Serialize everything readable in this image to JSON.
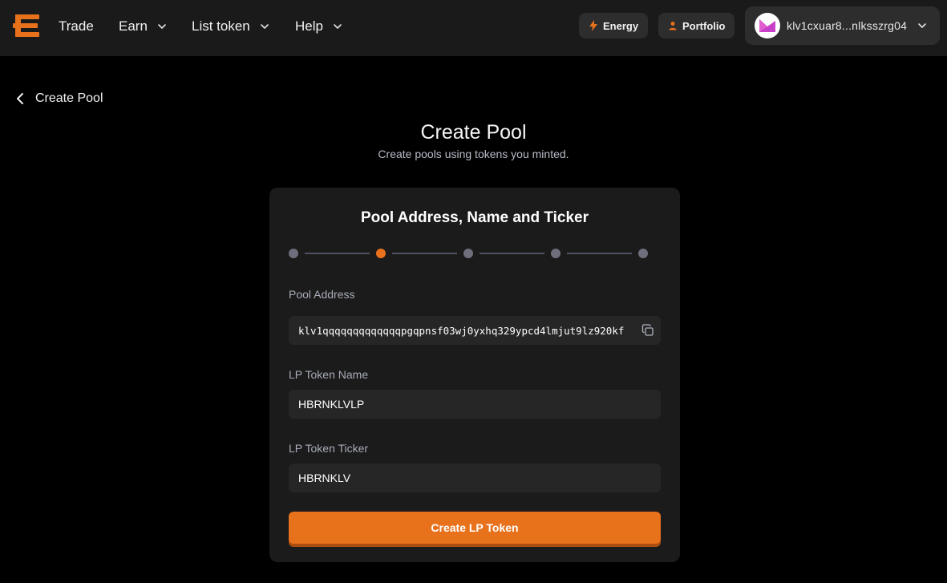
{
  "nav": {
    "items": [
      {
        "label": "Trade",
        "has_dropdown": false
      },
      {
        "label": "Earn",
        "has_dropdown": true
      },
      {
        "label": "List token",
        "has_dropdown": true
      },
      {
        "label": "Help",
        "has_dropdown": true
      }
    ],
    "energy_label": "Energy",
    "portfolio_label": "Portfolio",
    "wallet_address": "klv1cxuar8...nlksszrg04"
  },
  "back": {
    "label": "Create Pool"
  },
  "header": {
    "title": "Create Pool",
    "subtitle": "Create pools using tokens you minted."
  },
  "card": {
    "title": "Pool Address, Name and Ticker",
    "stepper": {
      "total_steps": 5,
      "current_step": 2
    },
    "pool_address": {
      "label": "Pool Address",
      "value": "klv1qqqqqqqqqqqqqpgqpnsf03wj0yxhq329ypcd4lmjut9lz920kf"
    },
    "lp_token_name": {
      "label": "LP Token Name",
      "value": "HBRNKLVLP"
    },
    "lp_token_ticker": {
      "label": "LP Token Ticker",
      "value": "HBRNKLV"
    },
    "submit_label": "Create LP Token"
  },
  "colors": {
    "accent": "#e8711c",
    "background": "#000000",
    "topbar": "#1a1a1a",
    "card": "#1b1b1b",
    "field": "#262626",
    "muted_text": "#a8acb8"
  }
}
